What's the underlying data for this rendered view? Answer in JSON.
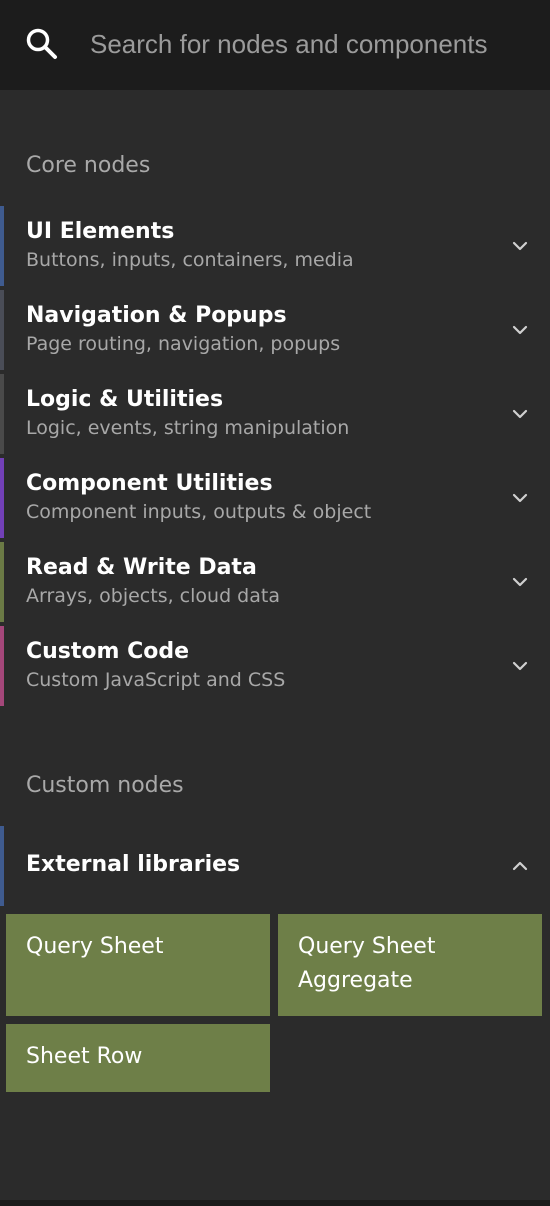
{
  "search": {
    "icon": "search-icon",
    "placeholder": "Search for nodes and components"
  },
  "core_heading": "Core nodes",
  "categories": [
    {
      "title": "UI Elements",
      "subtitle": "Buttons, inputs, containers, media",
      "accent": "#3f5b8f",
      "icon": "chevron-down-icon"
    },
    {
      "title": "Navigation & Popups",
      "subtitle": "Page routing, navigation, popups",
      "accent": "#4a4d57",
      "icon": "chevron-down-icon"
    },
    {
      "title": "Logic & Utilities",
      "subtitle": "Logic, events, string manipulation",
      "accent": "#4a4a4a",
      "icon": "chevron-down-icon"
    },
    {
      "title": "Component Utilities",
      "subtitle": "Component inputs, outputs & object",
      "accent": "#7240b7",
      "icon": "chevron-down-icon"
    },
    {
      "title": "Read & Write Data",
      "subtitle": "Arrays, objects, cloud data",
      "accent": "#6b7a45",
      "icon": "chevron-down-icon"
    },
    {
      "title": "Custom Code",
      "subtitle": "Custom JavaScript and CSS",
      "accent": "#a4477a",
      "icon": "chevron-down-icon"
    }
  ],
  "custom_heading": "Custom nodes",
  "external_libraries": {
    "title": "External libraries",
    "accent": "#3f5b8f",
    "icon": "chevron-up-icon",
    "expanded": true,
    "nodes": [
      {
        "label": "Query Sheet"
      },
      {
        "label": "Query Sheet Aggregate"
      },
      {
        "label": "Sheet Row"
      }
    ],
    "tile_color": "#6e7f48"
  }
}
